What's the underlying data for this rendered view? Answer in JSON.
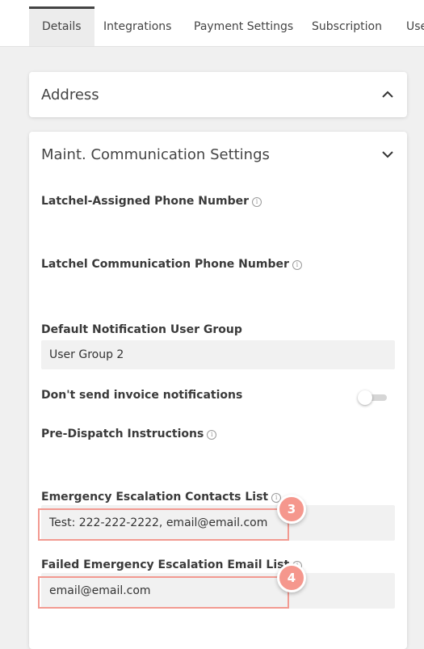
{
  "tabs": [
    {
      "label": "Details",
      "active": true
    },
    {
      "label": "Integrations"
    },
    {
      "label": "Payment Settings"
    },
    {
      "label": "Subscription"
    },
    {
      "label": "Use"
    }
  ],
  "address_section": {
    "title": "Address",
    "expanded": false
  },
  "maint_section": {
    "title": "Maint. Communication Settings",
    "expanded": true,
    "assigned_phone": {
      "label": "Latchel-Assigned Phone Number",
      "value": ""
    },
    "comm_phone": {
      "label": "Latchel Communication Phone Number",
      "value": ""
    },
    "user_group": {
      "label": "Default Notification User Group",
      "value": "User Group 2"
    },
    "invoice_notifications": {
      "label": "Don't send invoice notifications",
      "on": false
    },
    "pre_dispatch": {
      "label": "Pre-Dispatch Instructions",
      "value": ""
    },
    "escalation_contacts": {
      "label": "Emergency Escalation Contacts List",
      "value": "Test: 222-222-2222, email@email.com"
    },
    "failed_escalation": {
      "label": "Failed Emergency Escalation Email List",
      "value": "email@email.com"
    }
  },
  "annotations": {
    "badge_3": "3",
    "badge_4": "4",
    "color": "#f5978d"
  }
}
